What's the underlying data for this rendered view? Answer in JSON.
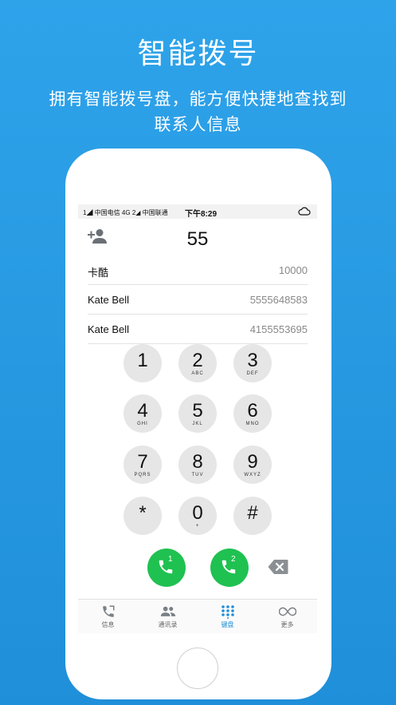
{
  "headline": "智能拨号",
  "subhead_line1": "拥有智能拨号盘，能方便快捷地查找到",
  "subhead_line2": "联系人信息",
  "status": {
    "sim1": "1",
    "carrier1": "中国电信 4G",
    "sim2": "2",
    "carrier2": "中国联通",
    "time": "下午8:29"
  },
  "dial": {
    "typed": "55"
  },
  "results": [
    {
      "name": "卡酷",
      "number": "10000"
    },
    {
      "name": "Kate Bell",
      "number": "5555648583"
    },
    {
      "name": "Kate Bell",
      "number": "4155553695"
    }
  ],
  "keys": [
    {
      "digit": "1",
      "letters": ""
    },
    {
      "digit": "2",
      "letters": "ABC"
    },
    {
      "digit": "3",
      "letters": "DEF"
    },
    {
      "digit": "4",
      "letters": "GHI"
    },
    {
      "digit": "5",
      "letters": "JKL"
    },
    {
      "digit": "6",
      "letters": "MNO"
    },
    {
      "digit": "7",
      "letters": "PQRS"
    },
    {
      "digit": "8",
      "letters": "TUV"
    },
    {
      "digit": "9",
      "letters": "WXYZ"
    },
    {
      "digit": "*",
      "letters": ""
    },
    {
      "digit": "0",
      "letters": "+"
    },
    {
      "digit": "#",
      "letters": ""
    }
  ],
  "calls": {
    "sim1_label": "1",
    "sim2_label": "2"
  },
  "tabs": [
    {
      "label": "信息",
      "icon": "phone-log-icon"
    },
    {
      "label": "通讯录",
      "icon": "contacts-icon"
    },
    {
      "label": "键盘",
      "icon": "keypad-icon"
    },
    {
      "label": "更多",
      "icon": "infinity-icon"
    }
  ],
  "colors": {
    "background": "#2ea3ea",
    "call_green": "#1fc151",
    "accent": "#1f8fd9",
    "key_gray": "#e6e6e6"
  }
}
